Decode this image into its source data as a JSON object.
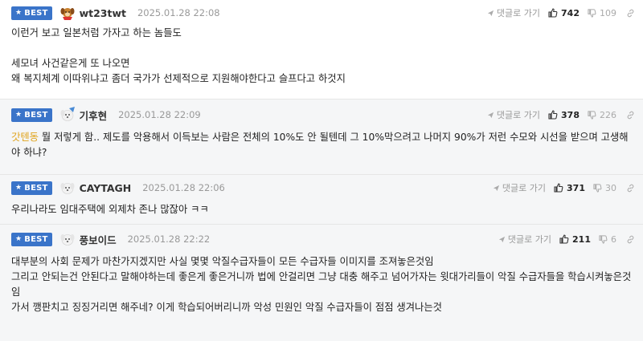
{
  "comments": [
    {
      "badge": "BEST",
      "nick": "wt23twt",
      "date": "2025.01.28 22:08",
      "reply_label": "댓글로 가기",
      "likes": "742",
      "dislikes": "109",
      "lines": [
        "이런거 보고 일본처럼 가자고 하는 놈들도",
        "",
        "세모녀 사건같은게 또 나오면",
        "왜 복지체계 이따위냐고 좀더 국가가 선제적으로 지원해야한다고 슬프다고 하것지"
      ]
    },
    {
      "badge": "BEST",
      "nick": "기후현",
      "date": "2025.01.28 22:09",
      "reply_label": "댓글로 가기",
      "likes": "378",
      "dislikes": "226",
      "mention": "갓텐동",
      "lines": [
        " 뭘 저렇게 함.. 제도를 악용해서 이득보는 사람은 전체의 10%도 안 될텐데 그 10%막으려고 나머지 90%가 저런 수모와 시선을 받으며 고생해야 하냐?"
      ]
    },
    {
      "badge": "BEST",
      "nick": "CAYTAGH",
      "date": "2025.01.28 22:06",
      "reply_label": "댓글로 가기",
      "likes": "371",
      "dislikes": "30",
      "lines": [
        "우리나라도 임대주택에 외제차 존나 많잖아 ㅋㅋ"
      ]
    },
    {
      "badge": "BEST",
      "nick": "풍보이드",
      "date": "2025.01.28 22:22",
      "reply_label": "댓글로 가기",
      "likes": "211",
      "dislikes": "6",
      "lines": [
        "대부분의 사회 문제가 마찬가지겠지만 사실 몇몇 악질수급자들이 모든 수급자들 이미지를 조져놓은것임",
        "그리고 안되는건 안된다고 말해야하는데 좋은게 좋은거니까 법에 안걸리면 그냥 대충 해주고 넘어가자는 윗대가리들이 악질 수급자들을 학습시켜놓은것임",
        "가서 깽판치고 징징거리면 해주네? 이게 학습되어버리니까 악성 민원인 악질 수급자들이 점점 생겨나는것"
      ]
    }
  ],
  "colors": {
    "badge": "#3a74c9",
    "mention": "#e0a31b",
    "alt_bg": "#f5f6f7"
  },
  "icons": {
    "badge": "star-icon",
    "reply": "reply-arrow-icon",
    "like": "thumbs-up-icon",
    "dislike": "thumbs-down-icon",
    "link": "link-icon"
  }
}
